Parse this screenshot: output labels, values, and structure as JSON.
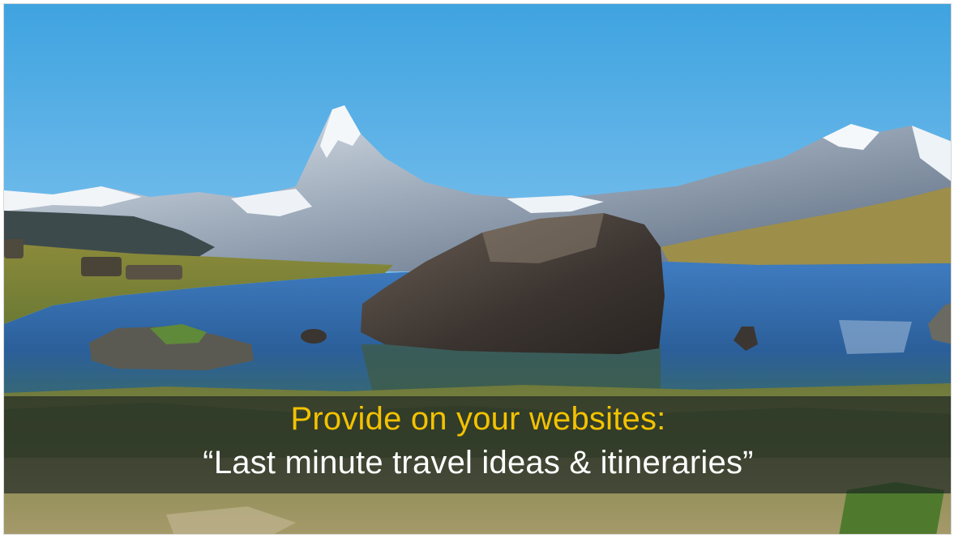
{
  "slide": {
    "caption": {
      "line1": "Provide on your websites:",
      "line2": "“Last minute travel ideas & itineraries”"
    }
  },
  "colors": {
    "headline_accent": "#f3c200",
    "quote_text": "#ffffff",
    "band": "#141c20"
  }
}
